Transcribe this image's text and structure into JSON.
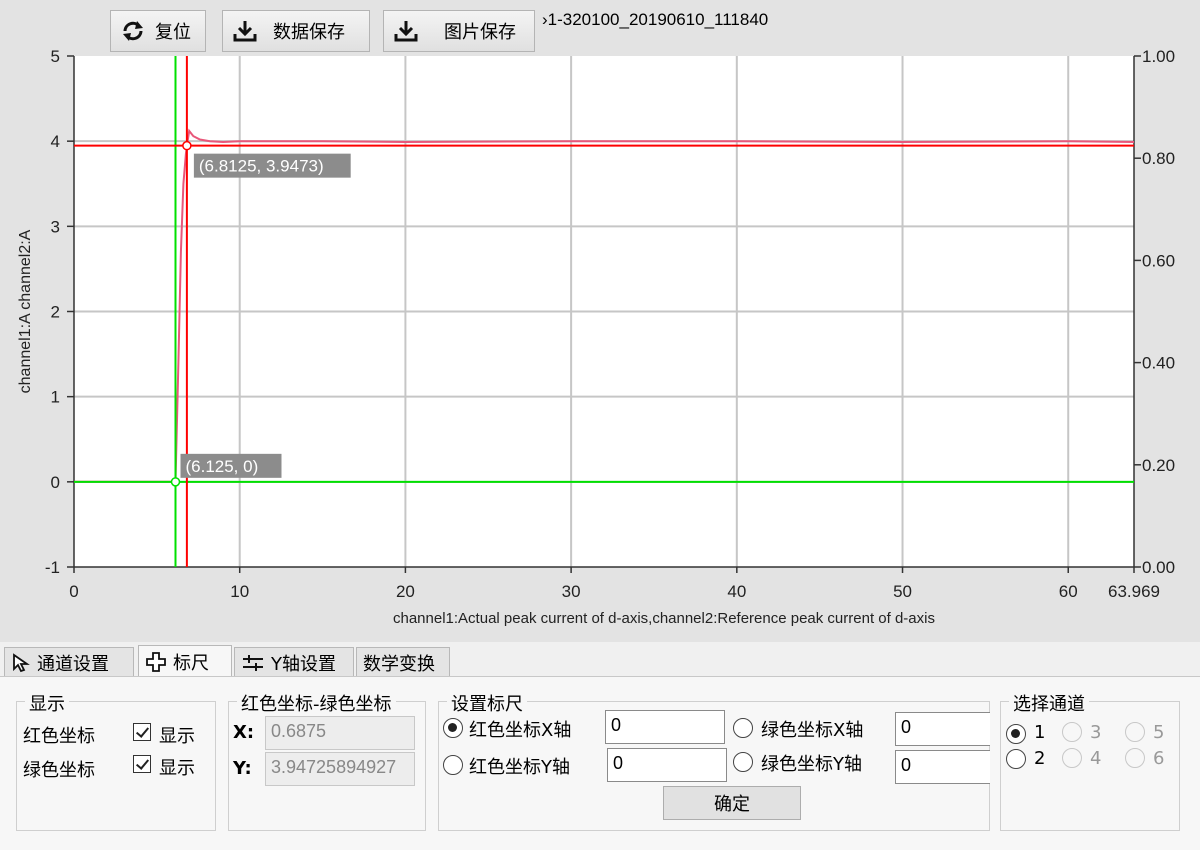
{
  "toolbar": {
    "reset_label": "复位",
    "save_data_label": "数据保存",
    "save_image_label": "图片保存"
  },
  "file_title": "›1-320100_20190610_111840",
  "chart_data": {
    "type": "line",
    "xlabel": "channel1:Actual peak current of d-axis,channel2:Reference peak current of d-axis",
    "ylabel": "channel1:A channel2:A",
    "xlim": [
      0,
      63.969
    ],
    "ylim": [
      -1,
      5
    ],
    "y2lim": [
      0.0,
      1.0
    ],
    "x_ticks": [
      "0",
      "10",
      "20",
      "30",
      "40",
      "50",
      "60",
      "63.969"
    ],
    "y_ticks": [
      "5",
      "4",
      "3",
      "2",
      "1",
      "0",
      "-1"
    ],
    "y2_ticks": [
      "1.00",
      "0.80",
      "0.60",
      "0.40",
      "0.20",
      "0.00"
    ],
    "grid": true,
    "series": [
      {
        "color": "#e8577a",
        "x": [
          0,
          6.0,
          6.125,
          6.3,
          6.45,
          6.6,
          6.75,
          6.8125,
          6.95,
          7.2,
          7.6,
          8.2,
          9.0,
          10,
          15,
          20,
          30,
          40,
          50,
          60,
          63.969
        ],
        "y": [
          0,
          0,
          0,
          1.4,
          2.7,
          3.5,
          3.85,
          3.9473,
          4.12,
          4.06,
          4.02,
          4.0,
          3.99,
          4.0,
          4.0,
          3.99,
          4.0,
          4.0,
          3.99,
          4.0,
          3.99
        ]
      }
    ],
    "cursors": {
      "red": {
        "color": "#ff0000",
        "x": 6.8125,
        "y": 3.9473,
        "label": "(6.8125, 3.9473)"
      },
      "green": {
        "color": "#00e000",
        "x": 6.125,
        "y": 0,
        "label": "(6.125, 0)"
      }
    }
  },
  "tabs": [
    {
      "label": "通道设置",
      "icon": "cursor-arrow-icon",
      "active": false
    },
    {
      "label": "标尺",
      "icon": "crosshair-icon",
      "active": true
    },
    {
      "label": "Y轴设置",
      "icon": "axis-settings-icon",
      "active": false
    },
    {
      "label": "数学变换",
      "icon": "",
      "active": false
    }
  ],
  "display_group": {
    "title": "显示",
    "red_label": "红色坐标",
    "red_check": "显示",
    "green_label": "绿色坐标",
    "green_check": "显示"
  },
  "diff_group": {
    "title": "红色坐标-绿色坐标",
    "x_label": "X:",
    "x_value": "0.6875",
    "y_label": "Y:",
    "y_value": "3.94725894927"
  },
  "ruler_group": {
    "title": "设置标尺",
    "red_x_label": "红色坐标X轴",
    "red_x_value": "0",
    "red_y_label": "红色坐标Y轴",
    "red_y_value": "0",
    "green_x_label": "绿色坐标X轴",
    "green_x_value": "0",
    "green_y_label": "绿色坐标Y轴",
    "green_y_value": "0",
    "confirm_label": "确定"
  },
  "channel_group": {
    "title": "选择通道",
    "channels": [
      "1",
      "3",
      "5",
      "2",
      "4",
      "6"
    ]
  }
}
